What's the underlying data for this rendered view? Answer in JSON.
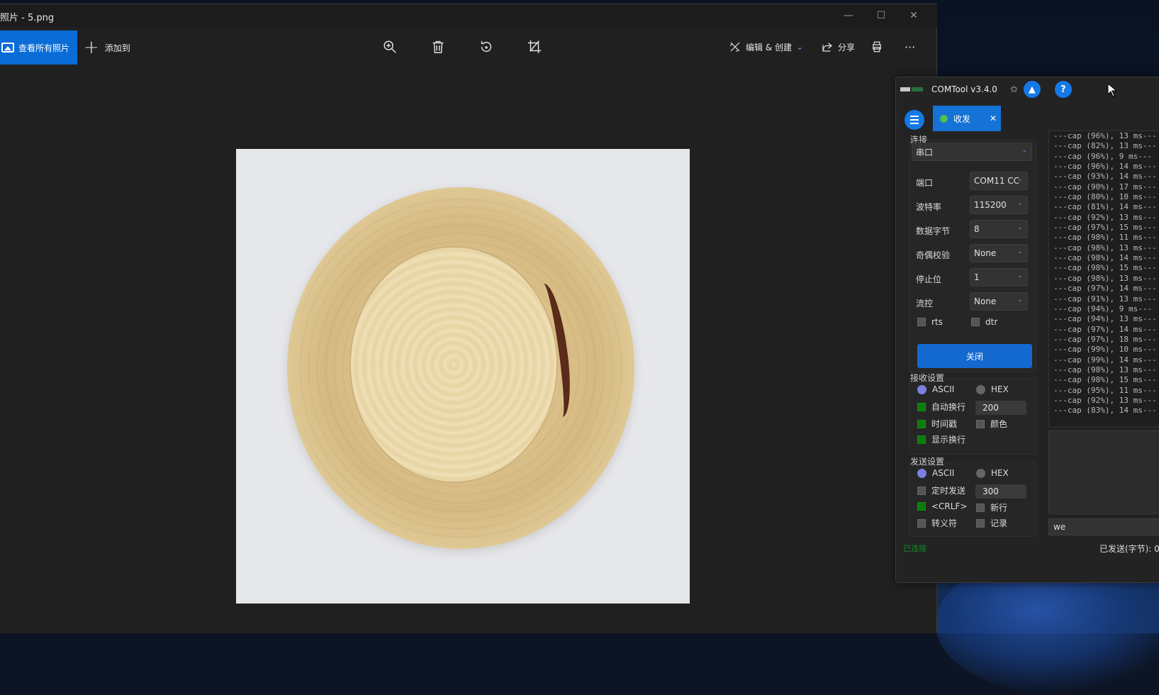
{
  "photos": {
    "title": "照片 - 5.png",
    "view_all_label": "查看所有照片",
    "add_to_label": "添加到",
    "edit_create_label": "编辑 & 创建",
    "share_label": "分享",
    "more_label": "···",
    "min_glyph": "—",
    "max_glyph": "☐",
    "close_glyph": "✕"
  },
  "comtool": {
    "title": "COMTool v3.4.0",
    "tab_label": "收发",
    "tab_close": "✕",
    "help_glyph": "?",
    "connection": {
      "group_label": "连接",
      "type_value": "串口",
      "port_label": "端口",
      "port_value": "COM11 CC",
      "baud_label": "波特率",
      "baud_value": "115200",
      "databits_label": "数据字节",
      "databits_value": "8",
      "parity_label": "奇偶校验",
      "parity_value": "None",
      "stopbits_label": "停止位",
      "stopbits_value": "1",
      "flow_label": "流控",
      "flow_value": "None",
      "rts_label": "rts",
      "dtr_label": "dtr",
      "close_button": "关闭"
    },
    "receive": {
      "group_label": "接收设置",
      "ascii_label": "ASCII",
      "hex_label": "HEX",
      "autowrap_label": "自动换行",
      "autowrap_value": "200",
      "timestamp_label": "时间戳",
      "color_label": "颜色",
      "show_newline_label": "显示换行"
    },
    "send": {
      "group_label": "发送设置",
      "ascii_label": "ASCII",
      "hex_label": "HEX",
      "timed_label": "定时发送",
      "timed_value": "300",
      "crlf_label": "<CRLF>",
      "newline_label": "新行",
      "escape_label": "转义符",
      "record_label": "记录",
      "input_value": "we"
    },
    "log_lines": [
      "---cap (96%), 13 ms---",
      "---cap (82%), 13 ms---",
      "---cap (96%), 9 ms---",
      "---cap (96%), 14 ms---",
      "---cap (93%), 14 ms---",
      "---cap (90%), 17 ms---",
      "---cap (80%), 10 ms---",
      "---cap (81%), 14 ms---",
      "---cap (92%), 13 ms---",
      "---cap (97%), 15 ms---",
      "---cap (98%), 11 ms---",
      "---cap (98%), 13 ms---",
      "---cap (98%), 14 ms---",
      "---cap (98%), 15 ms---",
      "---cap (98%), 13 ms---",
      "---cap (97%), 14 ms---",
      "---cap (91%), 13 ms---",
      "---cap (94%), 9 ms---",
      "---cap (94%), 13 ms---",
      "---cap (97%), 14 ms---",
      "---cap (97%), 18 ms---",
      "---cap (99%), 10 ms---",
      "---cap (99%), 14 ms---",
      "---cap (98%), 13 ms---",
      "---cap (98%), 15 ms---",
      "---cap (95%), 11 ms---",
      "---cap (92%), 13 ms---",
      "---cap (83%), 14 ms---"
    ],
    "status_connected": "已连接",
    "status_sent": "已发送(字节): 0"
  },
  "colors": {
    "accent": "#1479e6",
    "connected": "#0f8a2a",
    "check_on": "#0c7a0c",
    "radio_on": "#7b7fe0"
  }
}
